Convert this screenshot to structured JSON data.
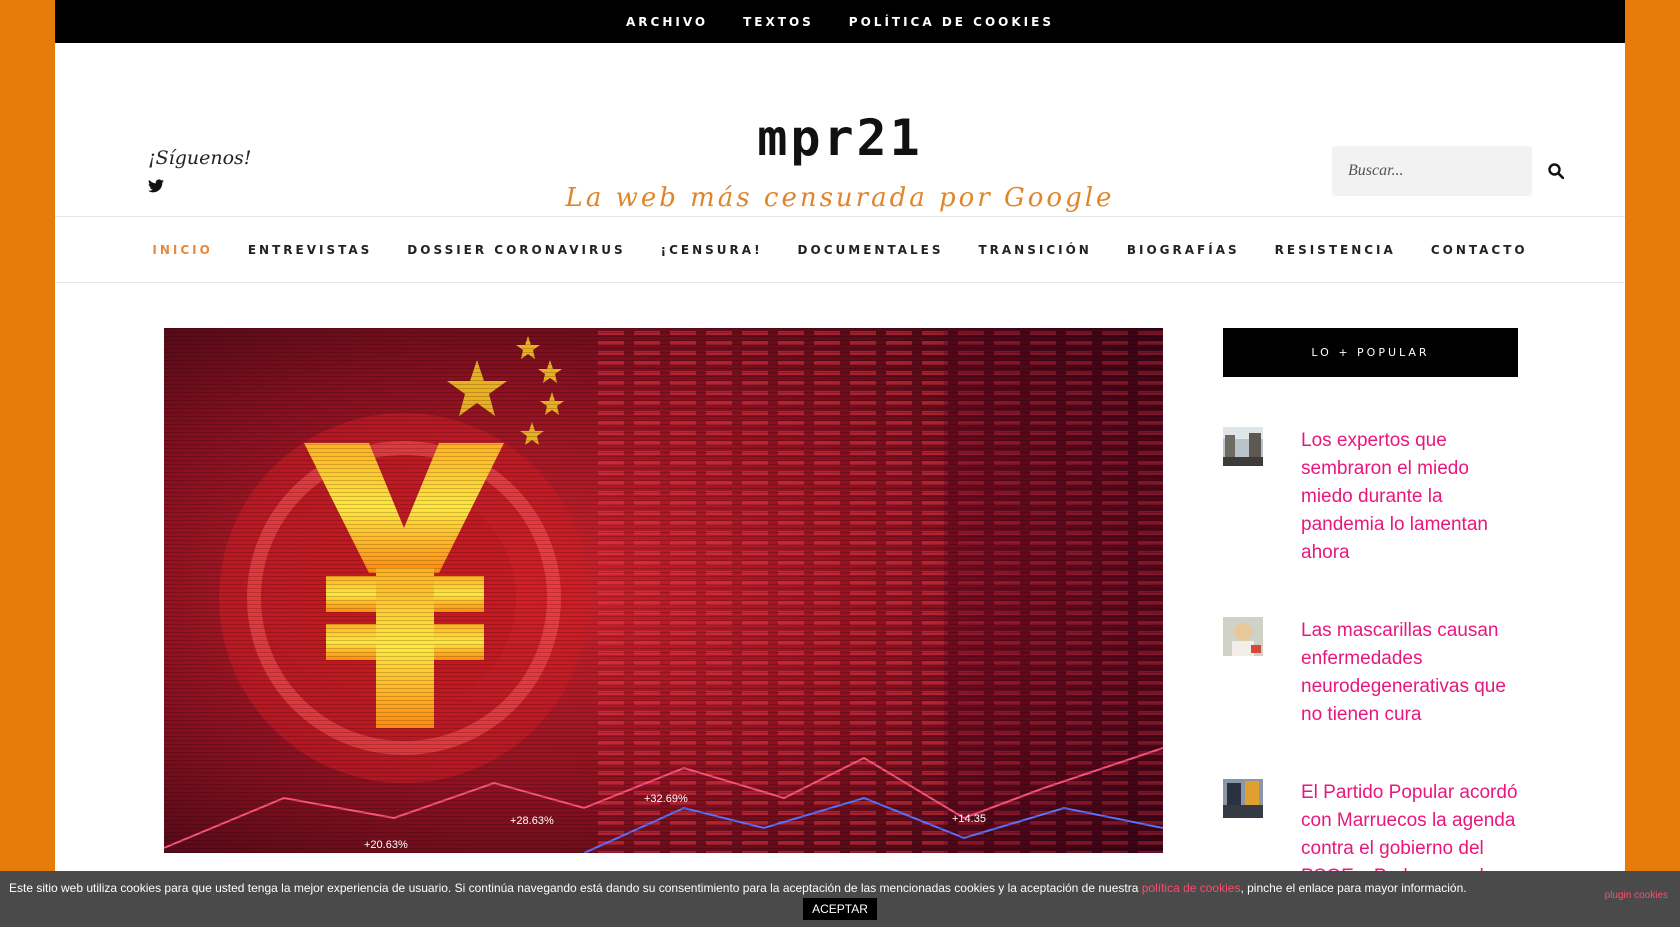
{
  "top_nav": {
    "items": [
      {
        "label": "ARCHIVO"
      },
      {
        "label": "TEXTOS"
      },
      {
        "label": "POLÍTICA DE COOKIES"
      }
    ]
  },
  "header": {
    "follow_label": "¡Síguenos!",
    "social_icon": "twitter-icon",
    "site_title": "mpr21",
    "tagline": "La web más censurada por Google",
    "search": {
      "placeholder": "Buscar...",
      "icon": "search-icon"
    }
  },
  "main_nav": {
    "items": [
      {
        "label": "INICIO",
        "active": true
      },
      {
        "label": "ENTREVISTAS",
        "active": false
      },
      {
        "label": "DOSSIER CORONAVIRUS",
        "active": false
      },
      {
        "label": "¡CENSURA!",
        "active": false
      },
      {
        "label": "DOCUMENTALES",
        "active": false
      },
      {
        "label": "TRANSICIÓN",
        "active": false
      },
      {
        "label": "BIOGRAFÍAS",
        "active": false
      },
      {
        "label": "RESISTENCIA",
        "active": false
      },
      {
        "label": "CONTACTO",
        "active": false
      }
    ]
  },
  "featured_image": {
    "overlay_values": [
      "+32.69%",
      "+28.63%",
      "+20.63%",
      "+14.35"
    ]
  },
  "sidebar": {
    "widget_title": "LO + POPULAR",
    "items": [
      {
        "title": "Los expertos que sembraron el miedo miedo durante la pandemia lo lamentan ahora"
      },
      {
        "title": "Las mascarillas causan enfermedades neurodegenerativas que no tienen cura"
      },
      {
        "title": "El Partido Popular acordó con Marruecos la agenda contra el gobierno del PSOE y Podemos, y han tenido éxito"
      }
    ]
  },
  "cookie_bar": {
    "text_before": "Este sitio web utiliza cookies para que usted tenga la mejor experiencia de usuario. Si continúa navegando está dando su consentimiento para la aceptación de las mencionadas cookies y la aceptación de nuestra ",
    "link": "política de cookies",
    "text_after": ", pinche el enlace para mayor información.",
    "plugin_link": "plugin cookies",
    "accept_label": "ACEPTAR"
  },
  "colors": {
    "background": "#e87c0a",
    "accent_active_nav": "#e8883a",
    "popular_link": "#e8177d",
    "cookie_link": "#ff4a6d"
  }
}
